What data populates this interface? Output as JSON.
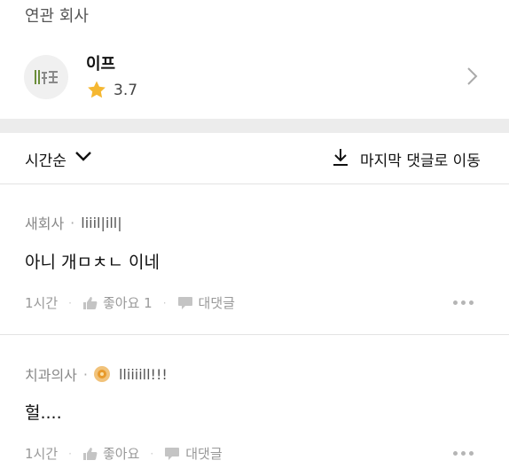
{
  "section": {
    "title": "연관 회사"
  },
  "company": {
    "name": "이프",
    "rating": "3.7",
    "logo_icon": "company-logo-icon",
    "star_color": "#f5b731"
  },
  "sort": {
    "label": "시간순",
    "jump_label": "마지막 댓글로 이동"
  },
  "comments": [
    {
      "author": "새회사",
      "nickname": "liiil|ill|",
      "body": "아니 개ㅁㅊㄴ 이네",
      "time": "1시간",
      "like_label": "좋아요 1",
      "reply_label": "대댓글",
      "has_badge": false
    },
    {
      "author": "치과의사",
      "nickname": "lliiiill!!!",
      "body": "헐....",
      "time": "1시간",
      "like_label": "좋아요",
      "reply_label": "대댓글",
      "has_badge": true
    }
  ]
}
